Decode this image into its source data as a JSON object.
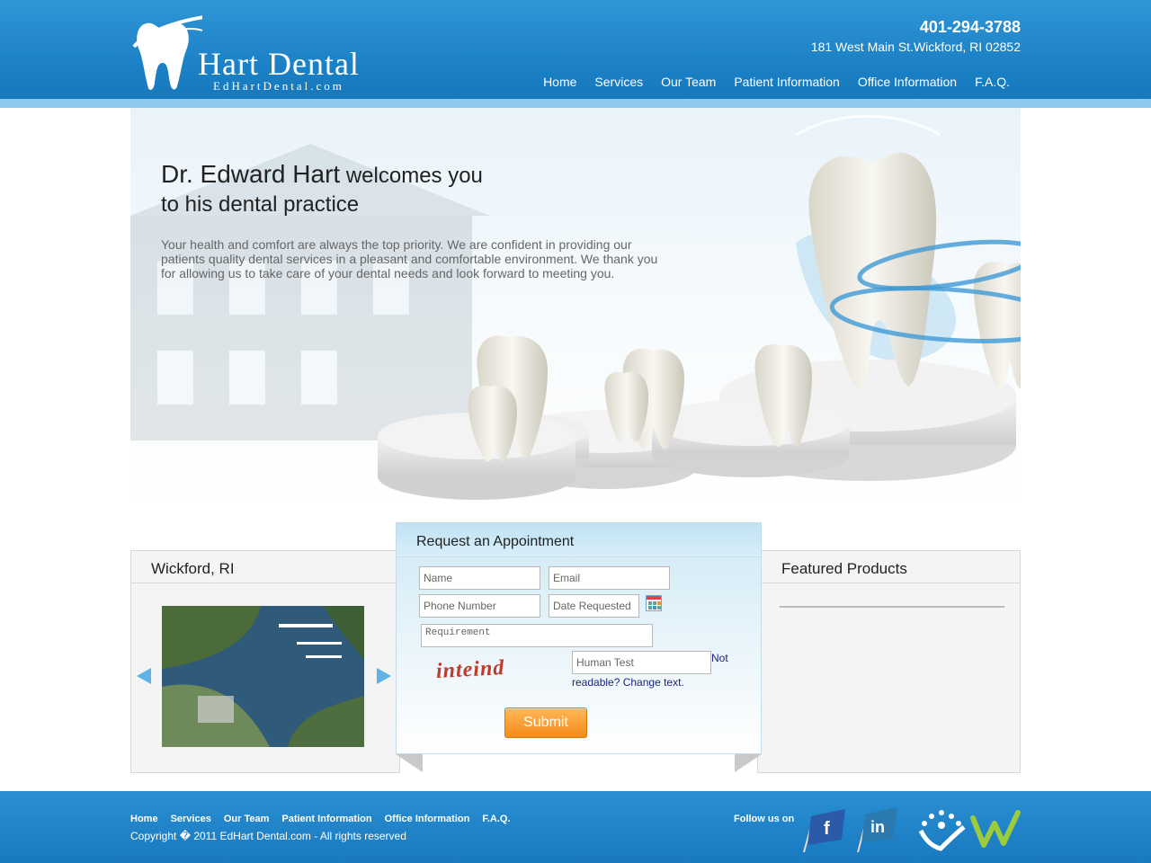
{
  "header": {
    "logo_text": "Hart Dental",
    "logo_sub": "EdHartDental.com",
    "phone": "401-294-3788",
    "address": "181 West Main St.Wickford, RI 02852",
    "nav": [
      "Home",
      "Services",
      "Our Team",
      "Patient Information",
      "Office Information",
      "F.A.Q."
    ]
  },
  "hero": {
    "title_name": "Dr. Edward Hart",
    "title_rest": " welcomes you",
    "title_line2": "to his dental practice",
    "text": "Your health and comfort are always the top priority. We are confident in providing our patients quality dental services in a pleasant and comfortable environment. We thank you for allowing us to take care of your dental needs and look forward to meeting you."
  },
  "location_box": {
    "title": "Wickford, RI"
  },
  "products_box": {
    "title": "Featured Products"
  },
  "appointment_form": {
    "title": "Request an Appointment",
    "name_placeholder": "Name",
    "email_placeholder": "Email",
    "phone_placeholder": "Phone Number",
    "date_placeholder": "Date Requested",
    "requirement_placeholder": "Requirement",
    "captcha_text": "inteind",
    "human_test_placeholder": "Human Test",
    "not_readable_1": "Not",
    "not_readable_2": "readable? Change text.",
    "submit_label": "Submit"
  },
  "footer": {
    "nav": [
      "Home",
      "Services",
      "Our Team",
      "Patient Information",
      "Office Information",
      "F.A.Q."
    ],
    "copyright": "Copyright � 2011 EdHart Dental.com - All rights reserved",
    "follow_label": "Follow us on",
    "social_icons": [
      "facebook-icon",
      "linkedin-icon",
      "review-icon",
      "w-icon"
    ]
  },
  "colors": {
    "header_blue": "#1a7fc4",
    "submit_orange": "#f48a18",
    "arrow_blue": "#5fb1e6"
  }
}
